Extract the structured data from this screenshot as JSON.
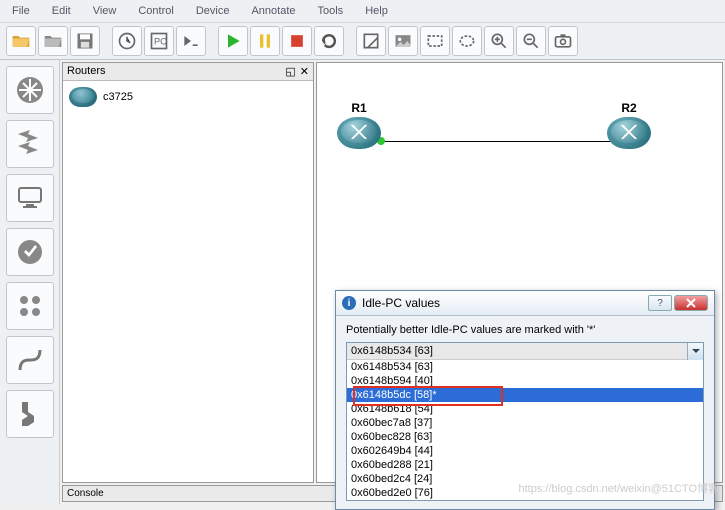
{
  "menu": [
    "File",
    "Edit",
    "View",
    "Control",
    "Device",
    "Annotate",
    "Tools",
    "Help"
  ],
  "left_tools": [
    "router-group",
    "switch-group",
    "endhost-group",
    "security-group",
    "link-tool",
    "custom-group",
    "connector-tool"
  ],
  "routers_panel": {
    "title": "Routers",
    "item": "c3725"
  },
  "topology": {
    "r1": "R1",
    "r2": "R2"
  },
  "console_title": "Console",
  "dialog": {
    "title": "Idle-PC values",
    "hint": "Potentially better Idle-PC values are marked with '*'",
    "selected": "0x6148b534 [63]",
    "options": [
      "0x6148b534 [63]",
      "0x6148b594 [40]",
      "0x6148b5dc [58]*",
      "0x6148b618 [54]",
      "0x60bec7a8 [37]",
      "0x60bec828 [63]",
      "0x602649b4 [44]",
      "0x60bed288 [21]",
      "0x60bed2c4 [24]",
      "0x60bed2e0 [76]"
    ],
    "highlight_index": 2
  },
  "watermark": "https://blog.csdn.net/weixin@51CTO博客"
}
